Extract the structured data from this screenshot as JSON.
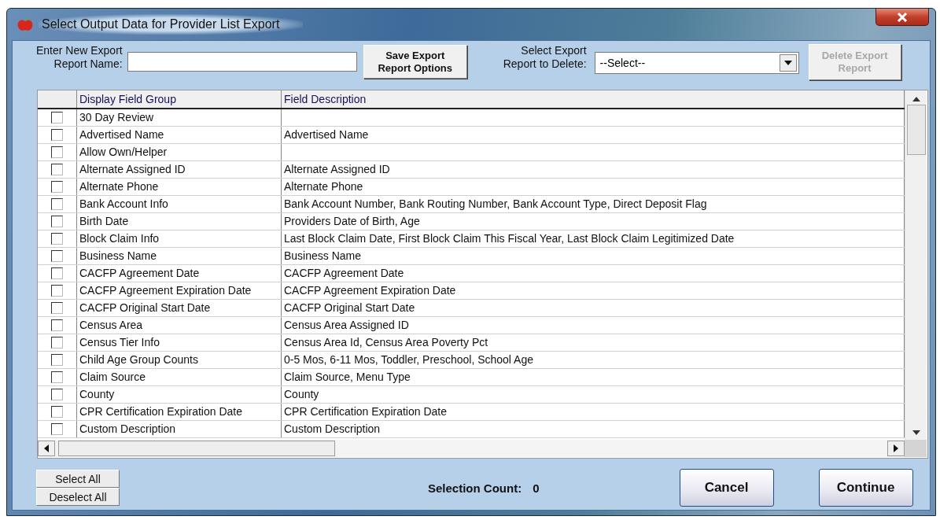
{
  "window": {
    "title": "Select Output Data for Provider List Export"
  },
  "new_report": {
    "label_line_1": "Enter New Export",
    "label_line_2": "Report Name:"
  },
  "save_button": {
    "line_1": "Save Export",
    "line_2": "Report Options"
  },
  "delete_select": {
    "label_line_1": "Select Export",
    "label_line_2": "Report to Delete:",
    "value": "--Select--"
  },
  "delete_button": {
    "line_1": "Delete Export",
    "line_2": "Report",
    "disabled": true
  },
  "table": {
    "columns": [
      "Display Field Group",
      "Field Description"
    ],
    "rows": [
      {
        "checked": false,
        "group": "30 Day Review"
      },
      {
        "checked": false,
        "group": "Advertised Name",
        "description": "Advertised Name"
      },
      {
        "checked": false,
        "group": "Allow Own/Helper"
      },
      {
        "checked": false,
        "group": "Alternate Assigned ID",
        "description": "Alternate Assigned ID"
      },
      {
        "checked": false,
        "group": "Alternate Phone",
        "description": "Alternate Phone"
      },
      {
        "checked": false,
        "group": "Bank Account Info",
        "description": "Bank Account Number, Bank Routing Number, Bank Account Type, Direct Deposit Flag"
      },
      {
        "checked": false,
        "group": "Birth Date",
        "description": "Providers Date of Birth, Age"
      },
      {
        "checked": false,
        "group": "Block Claim Info",
        "description": "Last Block Claim Date, First Block Claim This Fiscal Year, Last Block Claim Legitimized Date"
      },
      {
        "checked": false,
        "group": "Business Name",
        "description": "Business Name"
      },
      {
        "checked": false,
        "group": "CACFP Agreement Date",
        "description": "CACFP Agreement Date"
      },
      {
        "checked": false,
        "group": "CACFP Agreement Expiration Date",
        "description": "CACFP Agreement Expiration Date"
      },
      {
        "checked": false,
        "group": "CACFP Original Start Date",
        "description": "CACFP Original Start Date"
      },
      {
        "checked": false,
        "group": "Census Area",
        "description": "Census Area Assigned ID"
      },
      {
        "checked": false,
        "group": "Census Tier Info",
        "description": "Census Area Id, Census Area Poverty Pct"
      },
      {
        "checked": false,
        "group": "Child Age Group Counts",
        "description": "0-5 Mos, 6-11 Mos, Toddler, Preschool, School Age"
      },
      {
        "checked": false,
        "group": "Claim Source",
        "description": "Claim Source, Menu Type"
      },
      {
        "checked": false,
        "group": "County",
        "description": "County"
      },
      {
        "checked": false,
        "group": "CPR Certification Expiration Date",
        "description": "CPR Certification Expiration Date"
      },
      {
        "checked": false,
        "group": "Custom Description",
        "description": "Custom Description"
      }
    ]
  },
  "select_all": "Select All",
  "deselect_all": "Deselect All",
  "selection_count": {
    "label": "Selection Count:",
    "value": "0"
  },
  "buttons": [
    "Cancel",
    "Continue"
  ]
}
